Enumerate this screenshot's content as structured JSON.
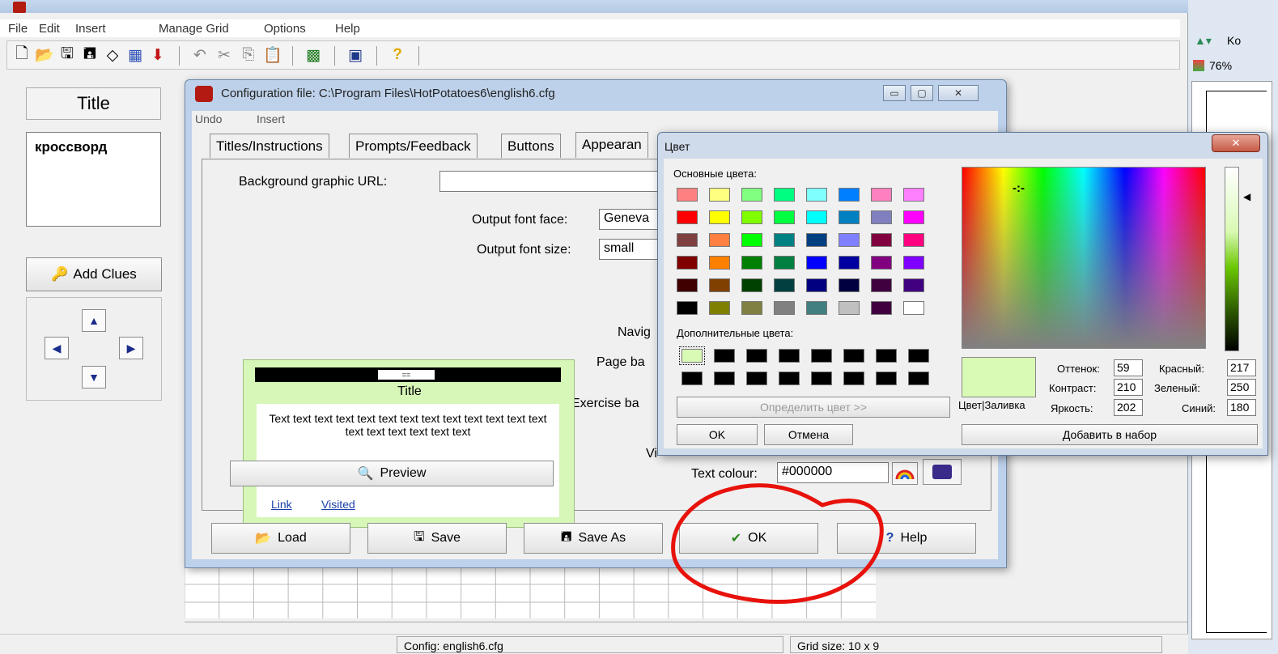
{
  "main_window": {
    "menu": [
      "File",
      "Edit",
      "Insert",
      "Manage Grid",
      "Options",
      "Help"
    ],
    "title_button": "Title",
    "title_text": "кроссворд",
    "add_clues": "Add Clues",
    "status": {
      "config": "Config: english6.cfg",
      "grid_size": "Grid size: 10 x 9"
    }
  },
  "side_fragment": {
    "zoom": "76%",
    "ko": "Ko"
  },
  "config_dialog": {
    "title": "Configuration file: C:\\Program Files\\HotPotatoes6\\english6.cfg",
    "menu": [
      "Undo",
      "Insert"
    ],
    "tabs": [
      "Titles/Instructions",
      "Prompts/Feedback",
      "Buttons",
      "Appearan"
    ],
    "fields": {
      "background_graphic_url_label": "Background graphic URL:",
      "background_graphic_url_value": "",
      "output_font_face_label": "Output font face:",
      "output_font_face_value": "Geneva",
      "output_font_size_label": "Output font size:",
      "output_font_size_value": "small",
      "navig_label": "Navig",
      "page_bg_label": "Page ba",
      "exercise_bg_label": "Exercise ba",
      "vi_label": "Vi",
      "text_colour_label": "Text colour:",
      "text_colour_value": "#000000"
    },
    "preview": {
      "bar_text": "==",
      "title": "Title",
      "body": "Text text text text text text text text text text text text text text text text text text text",
      "link": "Link",
      "visited": "Visited",
      "button": "Preview"
    },
    "buttons": {
      "load": "Load",
      "save": "Save",
      "save_as": "Save As",
      "ok": "OK",
      "help": "Help"
    }
  },
  "color_dialog": {
    "title": "Цвет",
    "basic_colors_label": "Основные цвета:",
    "custom_colors_label": "Дополнительные цвета:",
    "define_button": "Определить цвет >>",
    "ok": "OK",
    "cancel": "Отмена",
    "color_fill_label": "Цвет|Заливка",
    "add_to_set": "Добавить в набор",
    "hue_label": "Оттенок:",
    "hue": "59",
    "sat_label": "Контраст:",
    "sat": "210",
    "lum_label": "Яркость:",
    "lum": "202",
    "red_label": "Красный:",
    "red": "217",
    "green_label": "Зеленый:",
    "green": "250",
    "blue_label": "Синий:",
    "blue": "180",
    "basic_colors": [
      [
        "#ff8080",
        "#ffff80",
        "#80ff80",
        "#00ff80",
        "#80ffff",
        "#0080ff",
        "#ff80c0",
        "#ff80ff"
      ],
      [
        "#ff0000",
        "#ffff00",
        "#80ff00",
        "#00ff40",
        "#00ffff",
        "#0080c0",
        "#8080c0",
        "#ff00ff"
      ],
      [
        "#804040",
        "#ff8040",
        "#00ff00",
        "#008080",
        "#004080",
        "#8080ff",
        "#800040",
        "#ff0080"
      ],
      [
        "#800000",
        "#ff8000",
        "#008000",
        "#008040",
        "#0000ff",
        "#0000a0",
        "#800080",
        "#8000ff"
      ],
      [
        "#400000",
        "#804000",
        "#004000",
        "#004040",
        "#000080",
        "#000040",
        "#400040",
        "#400080"
      ],
      [
        "#000000",
        "#808000",
        "#808040",
        "#808080",
        "#408080",
        "#c0c0c0",
        "#400040",
        "#ffffff"
      ]
    ],
    "custom_colors": [
      [
        "#d9fab4",
        "#000000",
        "#000000",
        "#000000",
        "#000000",
        "#000000",
        "#000000",
        "#000000"
      ],
      [
        "#000000",
        "#000000",
        "#000000",
        "#000000",
        "#000000",
        "#000000",
        "#000000",
        "#000000"
      ]
    ]
  }
}
